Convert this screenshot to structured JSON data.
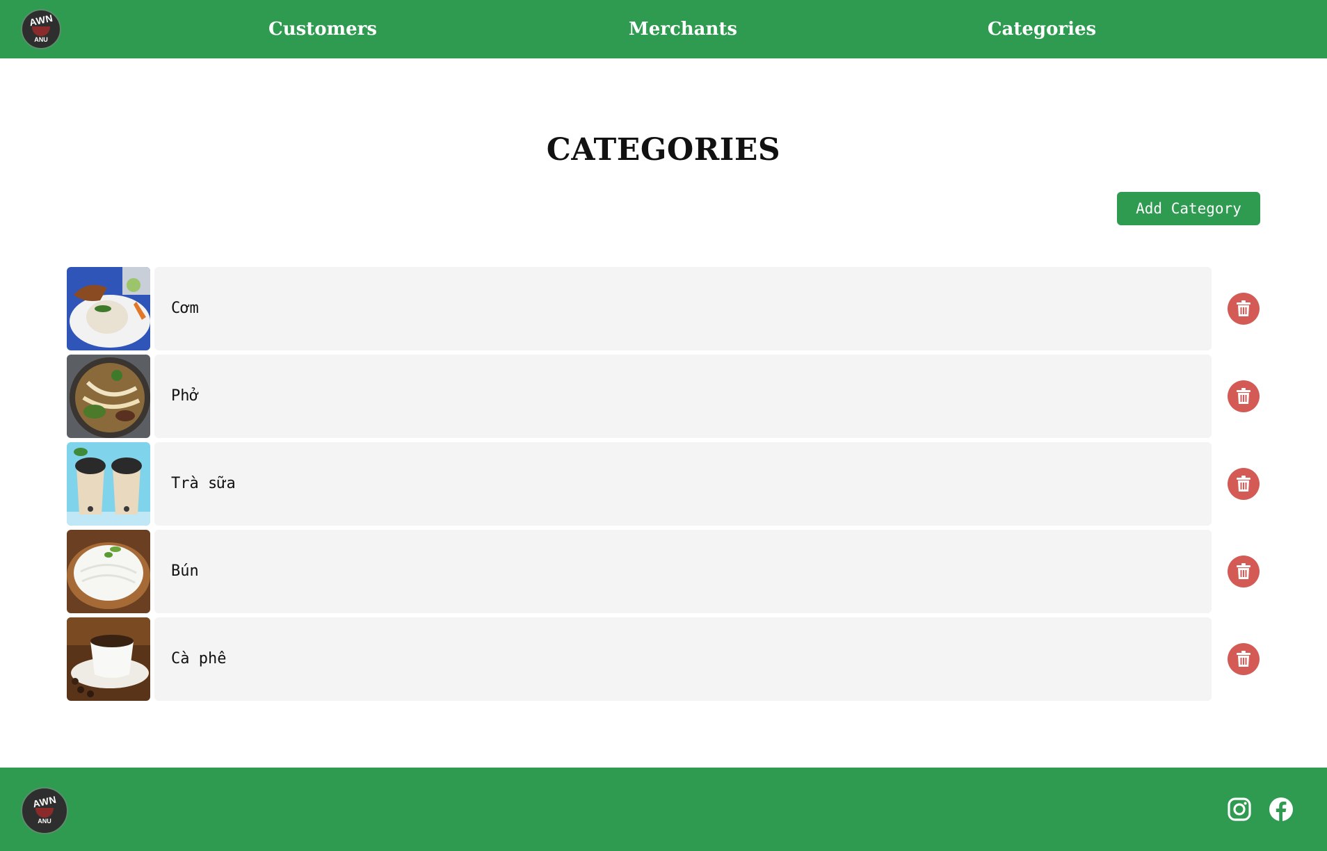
{
  "brand": {
    "logo_top": "AWN",
    "logo_bottom": "ANU"
  },
  "nav": {
    "links": [
      "Customers",
      "Merchants",
      "Categories"
    ]
  },
  "page": {
    "title": "CATEGORIES",
    "add_button": "Add Category"
  },
  "categories": [
    {
      "name": "Cơm",
      "image": "broken-rice-plate"
    },
    {
      "name": "Phở",
      "image": "pho-bowl"
    },
    {
      "name": "Trà sữa",
      "image": "bubble-milk-tea"
    },
    {
      "name": "Bún",
      "image": "rice-vermicelli"
    },
    {
      "name": "Cà phê",
      "image": "coffee-cup"
    }
  ],
  "icons": {
    "delete": "trash-icon",
    "instagram": "instagram-icon",
    "facebook": "facebook-icon"
  },
  "colors": {
    "primary": "#2e9b50",
    "delete": "#d45a55",
    "row_bg": "#f4f4f4"
  }
}
